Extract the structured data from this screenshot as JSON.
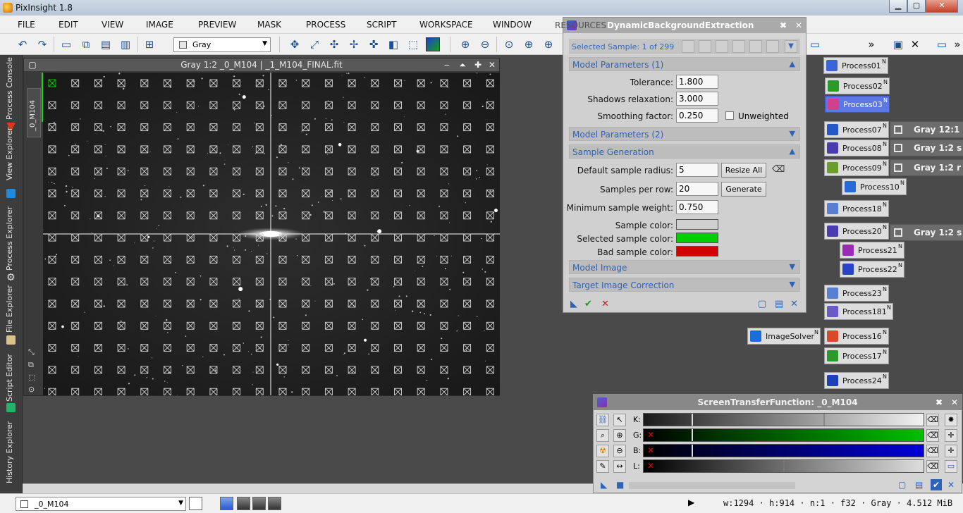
{
  "app": {
    "title": "PixInsight 1.8"
  },
  "window_controls": {
    "minimize": "▁",
    "maximize": "▢",
    "close": "✕"
  },
  "menu": [
    "FILE",
    "EDIT",
    "VIEW",
    "IMAGE",
    "PREVIEW",
    "MASK",
    "PROCESS",
    "SCRIPT",
    "WORKSPACE",
    "WINDOW",
    "RESOURCES"
  ],
  "toolbar": {
    "view_mode": "Gray"
  },
  "left_tabs": [
    "Process Console",
    "View Explorer",
    "Process Explorer",
    "File Explorer",
    "Script Editor",
    "History Explorer"
  ],
  "image_window": {
    "title": "Gray 1:2 _0_M104 | _1_M104_FINAL.fit",
    "side_tab": "_0_M104"
  },
  "dbe": {
    "ghost_title": "RESOURCES",
    "title": "DynamicBackgroundExtraction",
    "selected_sample": "Selected Sample: 1 of 299",
    "sections": {
      "model_params_1": "Model Parameters (1)",
      "model_params_2": "Model Parameters (2)",
      "sample_generation": "Sample Generation",
      "model_image": "Model Image",
      "target_correction": "Target Image Correction"
    },
    "fields": {
      "tolerance_label": "Tolerance:",
      "tolerance_value": "1.800",
      "shadows_label": "Shadows relaxation:",
      "shadows_value": "3.000",
      "smoothing_label": "Smoothing factor:",
      "smoothing_value": "0.250",
      "unweighted_label": "Unweighted",
      "radius_label": "Default sample radius:",
      "radius_value": "5",
      "resize_all": "Resize All",
      "per_row_label": "Samples per row:",
      "per_row_value": "20",
      "generate": "Generate",
      "min_weight_label": "Minimum sample weight:",
      "min_weight_value": "0.750",
      "sample_color_label": "Sample color:",
      "selected_color_label": "Selected sample color:",
      "bad_color_label": "Bad sample color:"
    },
    "colors": {
      "sample": "#d6d6d6",
      "selected": "#00d400",
      "bad": "#d80000"
    }
  },
  "process_icons": [
    {
      "label": "Process01",
      "selected": false,
      "icon": "#3b64d8"
    },
    {
      "label": "Process02",
      "selected": false,
      "icon": "#2a9a2a"
    },
    {
      "label": "Process03",
      "selected": true,
      "icon": "#d23f8f"
    },
    {
      "label": "Process07",
      "selected": false,
      "icon": "#2458c9"
    },
    {
      "label": "Process08",
      "selected": false,
      "icon": "#4a3bb0"
    },
    {
      "label": "Process09",
      "selected": false,
      "icon": "#6b9c2e"
    },
    {
      "label": "Process10",
      "selected": false,
      "icon": "#2a6ad8"
    },
    {
      "label": "Process18",
      "selected": false,
      "icon": "#5b7fd0"
    },
    {
      "label": "Process20",
      "selected": false,
      "icon": "#4a3bb0"
    },
    {
      "label": "Process21",
      "selected": false,
      "icon": "#9a2ab8"
    },
    {
      "label": "Process22",
      "selected": false,
      "icon": "#2a44c8"
    },
    {
      "label": "Process23",
      "selected": false,
      "icon": "#5b7fd0"
    },
    {
      "label": "Process181",
      "selected": false,
      "icon": "#6a5ac8"
    },
    {
      "label": "ImageSolver",
      "selected": false,
      "icon": "#1d6bd6"
    },
    {
      "label": "Process16",
      "selected": false,
      "icon": "#d6492a"
    },
    {
      "label": "Process17",
      "selected": false,
      "icon": "#2a9a2a"
    },
    {
      "label": "Process24",
      "selected": false,
      "icon": "#1d3fb8"
    }
  ],
  "view_icons": [
    "Gray 12:1",
    "Gray 1:2 s",
    "Gray 1:2 r",
    "Gray 1:2 s"
  ],
  "stf": {
    "title": "ScreenTransferFunction: _0_M104",
    "rows": [
      {
        "label": "K:",
        "color": "#1a1a1a",
        "end": "#f2f2f2"
      },
      {
        "label": "G:",
        "color": "#000",
        "end": "#00c000"
      },
      {
        "label": "B:",
        "color": "#000",
        "end": "#0000d8"
      },
      {
        "label": "L:",
        "color": "#000",
        "end": "#dddddd"
      }
    ]
  },
  "status": {
    "view": "_0_M104",
    "info": "w:1294 · h:914 · n:1 · f32 · Gray · 4.512 MiB"
  }
}
